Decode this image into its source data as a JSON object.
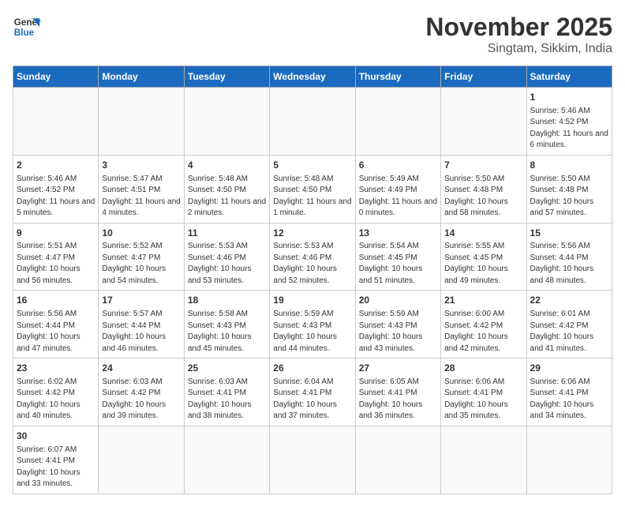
{
  "header": {
    "logo_general": "General",
    "logo_blue": "Blue",
    "title": "November 2025",
    "subtitle": "Singtam, Sikkim, India"
  },
  "weekdays": [
    "Sunday",
    "Monday",
    "Tuesday",
    "Wednesday",
    "Thursday",
    "Friday",
    "Saturday"
  ],
  "days": [
    {
      "date": "",
      "info": ""
    },
    {
      "date": "",
      "info": ""
    },
    {
      "date": "",
      "info": ""
    },
    {
      "date": "",
      "info": ""
    },
    {
      "date": "",
      "info": ""
    },
    {
      "date": "",
      "info": ""
    },
    {
      "date": "1",
      "info": "Sunrise: 5:46 AM\nSunset: 4:52 PM\nDaylight: 11 hours\nand 6 minutes."
    },
    {
      "date": "2",
      "info": "Sunrise: 5:46 AM\nSunset: 4:52 PM\nDaylight: 11 hours\nand 5 minutes."
    },
    {
      "date": "3",
      "info": "Sunrise: 5:47 AM\nSunset: 4:51 PM\nDaylight: 11 hours\nand 4 minutes."
    },
    {
      "date": "4",
      "info": "Sunrise: 5:48 AM\nSunset: 4:50 PM\nDaylight: 11 hours\nand 2 minutes."
    },
    {
      "date": "5",
      "info": "Sunrise: 5:48 AM\nSunset: 4:50 PM\nDaylight: 11 hours\nand 1 minute."
    },
    {
      "date": "6",
      "info": "Sunrise: 5:49 AM\nSunset: 4:49 PM\nDaylight: 11 hours\nand 0 minutes."
    },
    {
      "date": "7",
      "info": "Sunrise: 5:50 AM\nSunset: 4:48 PM\nDaylight: 10 hours\nand 58 minutes."
    },
    {
      "date": "8",
      "info": "Sunrise: 5:50 AM\nSunset: 4:48 PM\nDaylight: 10 hours\nand 57 minutes."
    },
    {
      "date": "9",
      "info": "Sunrise: 5:51 AM\nSunset: 4:47 PM\nDaylight: 10 hours\nand 56 minutes."
    },
    {
      "date": "10",
      "info": "Sunrise: 5:52 AM\nSunset: 4:47 PM\nDaylight: 10 hours\nand 54 minutes."
    },
    {
      "date": "11",
      "info": "Sunrise: 5:53 AM\nSunset: 4:46 PM\nDaylight: 10 hours\nand 53 minutes."
    },
    {
      "date": "12",
      "info": "Sunrise: 5:53 AM\nSunset: 4:46 PM\nDaylight: 10 hours\nand 52 minutes."
    },
    {
      "date": "13",
      "info": "Sunrise: 5:54 AM\nSunset: 4:45 PM\nDaylight: 10 hours\nand 51 minutes."
    },
    {
      "date": "14",
      "info": "Sunrise: 5:55 AM\nSunset: 4:45 PM\nDaylight: 10 hours\nand 49 minutes."
    },
    {
      "date": "15",
      "info": "Sunrise: 5:56 AM\nSunset: 4:44 PM\nDaylight: 10 hours\nand 48 minutes."
    },
    {
      "date": "16",
      "info": "Sunrise: 5:56 AM\nSunset: 4:44 PM\nDaylight: 10 hours\nand 47 minutes."
    },
    {
      "date": "17",
      "info": "Sunrise: 5:57 AM\nSunset: 4:44 PM\nDaylight: 10 hours\nand 46 minutes."
    },
    {
      "date": "18",
      "info": "Sunrise: 5:58 AM\nSunset: 4:43 PM\nDaylight: 10 hours\nand 45 minutes."
    },
    {
      "date": "19",
      "info": "Sunrise: 5:59 AM\nSunset: 4:43 PM\nDaylight: 10 hours\nand 44 minutes."
    },
    {
      "date": "20",
      "info": "Sunrise: 5:59 AM\nSunset: 4:43 PM\nDaylight: 10 hours\nand 43 minutes."
    },
    {
      "date": "21",
      "info": "Sunrise: 6:00 AM\nSunset: 4:42 PM\nDaylight: 10 hours\nand 42 minutes."
    },
    {
      "date": "22",
      "info": "Sunrise: 6:01 AM\nSunset: 4:42 PM\nDaylight: 10 hours\nand 41 minutes."
    },
    {
      "date": "23",
      "info": "Sunrise: 6:02 AM\nSunset: 4:42 PM\nDaylight: 10 hours\nand 40 minutes."
    },
    {
      "date": "24",
      "info": "Sunrise: 6:03 AM\nSunset: 4:42 PM\nDaylight: 10 hours\nand 39 minutes."
    },
    {
      "date": "25",
      "info": "Sunrise: 6:03 AM\nSunset: 4:41 PM\nDaylight: 10 hours\nand 38 minutes."
    },
    {
      "date": "26",
      "info": "Sunrise: 6:04 AM\nSunset: 4:41 PM\nDaylight: 10 hours\nand 37 minutes."
    },
    {
      "date": "27",
      "info": "Sunrise: 6:05 AM\nSunset: 4:41 PM\nDaylight: 10 hours\nand 36 minutes."
    },
    {
      "date": "28",
      "info": "Sunrise: 6:06 AM\nSunset: 4:41 PM\nDaylight: 10 hours\nand 35 minutes."
    },
    {
      "date": "29",
      "info": "Sunrise: 6:06 AM\nSunset: 4:41 PM\nDaylight: 10 hours\nand 34 minutes."
    },
    {
      "date": "30",
      "info": "Sunrise: 6:07 AM\nSunset: 4:41 PM\nDaylight: 10 hours\nand 33 minutes."
    },
    {
      "date": "",
      "info": ""
    },
    {
      "date": "",
      "info": ""
    },
    {
      "date": "",
      "info": ""
    },
    {
      "date": "",
      "info": ""
    },
    {
      "date": "",
      "info": ""
    },
    {
      "date": "",
      "info": ""
    }
  ]
}
